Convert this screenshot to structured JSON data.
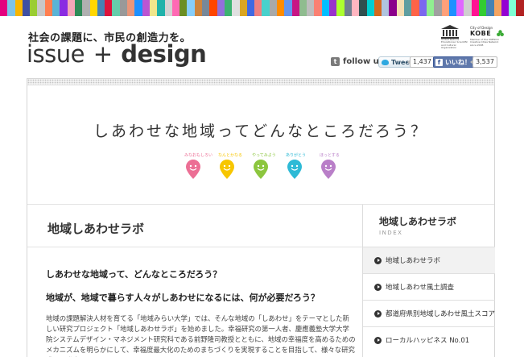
{
  "header": {
    "tagline": "社会の課題に、市民の創造力を。",
    "logo_issue": "issue",
    "logo_plus": "+",
    "logo_design": "design",
    "stripe_colors": [
      "#e4007f",
      "#7dc3e8",
      "#f8b500",
      "#3f4fa3",
      "#9acd32",
      "#c8c8c8",
      "#ff7f50",
      "#5ab4d6",
      "#8a2be2",
      "#f4a6b8",
      "#2e8b57",
      "#b0b0b0",
      "#ffd700",
      "#4682b4",
      "#dc143c",
      "#66cdaa",
      "#999999",
      "#e9967a",
      "#1e90ff",
      "#ba55d3",
      "#f0e68c",
      "#20b2aa",
      "#d3d3d3",
      "#ff69b4",
      "#6b8e23",
      "#87cefa",
      "#cd853f",
      "#778899",
      "#ff4500",
      "#9370db",
      "#3cb371",
      "#e0e0e0",
      "#daa520",
      "#4169e1",
      "#f08080",
      "#48d1cc",
      "#a9a9a9",
      "#ff8c00",
      "#6495ed",
      "#c71585",
      "#8fbc8f",
      "#bdbdbd",
      "#fa8072",
      "#00bfff",
      "#9932cc",
      "#adff2f",
      "#708090",
      "#ffb6c1",
      "#2f4f4f",
      "#00ced1",
      "#d2691e",
      "#b0c4de",
      "#8b008b",
      "#f5deb3",
      "#5f9ea0",
      "#ff6347",
      "#7b68ee",
      "#90ee90",
      "#a0a0a0",
      "#ffa07a",
      "#1e90ff",
      "#e066ff",
      "#cfcfcf",
      "#ff1493",
      "#32cd32",
      "#4682b4",
      "#f4a460",
      "#9400d3",
      "#7fffd4",
      "#b22222"
    ]
  },
  "unesco": {
    "name_lines": "United Nations Educational, Scientific and Cultural Organization",
    "city_label": "City of Design",
    "kobe_label": "KOBE",
    "member_lines": "Member of the UNESCO Creative Cities Network since 2008"
  },
  "social": {
    "follow_icon_text": "t",
    "follow_label": "follow us",
    "tweet_label": "Tweet",
    "tweet_count": "1,437",
    "like_label": "いいね！",
    "like_icon_text": "f",
    "like_count": "3,537"
  },
  "hero": {
    "title": "しあわせな地域ってどんなところだろう？",
    "pins": [
      {
        "caption": "みなおもしろい",
        "color": "#ec6f95"
      },
      {
        "caption": "なんとかなる",
        "color": "#f7c600"
      },
      {
        "caption": "やってみよう",
        "color": "#8cc63e"
      },
      {
        "caption": "ありがとう",
        "color": "#2ebad6"
      },
      {
        "caption": "ほっとする",
        "color": "#b97fc8"
      }
    ]
  },
  "main": {
    "section_title": "地域しあわせラボ",
    "question1": "しあわせな地域って、どんなところだろう？",
    "question2": "地域が、地域で暮らす人々がしあわせになるには、何が必要だろう？",
    "body": "地域の課題解決人材を育てる「地域みらい大学」では、そんな地域の「しあわせ」をテーマとした新しい研究プロジェクト「地域しあわせラボ」を始めました。幸福研究の第一人者、慶應義塾大学大学院システムデザイン・マネジメント研究科である前野隆司教授とともに、地域の幸福度を高めるためのメカニズムを明らかにして、幸福度最大化のためのまちづくりを実現することを目指して、様々な研究成果を発表していきます。"
  },
  "sidebar": {
    "title": "地域しあわせラボ",
    "subtitle": "INDEX",
    "items": [
      {
        "label": "地域しあわせラボ"
      },
      {
        "label": "地域しあわせ風土調査"
      },
      {
        "label": "都道府県別地域しあわせ風土スコア"
      },
      {
        "label": "ローカルハッピネス No.01"
      }
    ]
  }
}
